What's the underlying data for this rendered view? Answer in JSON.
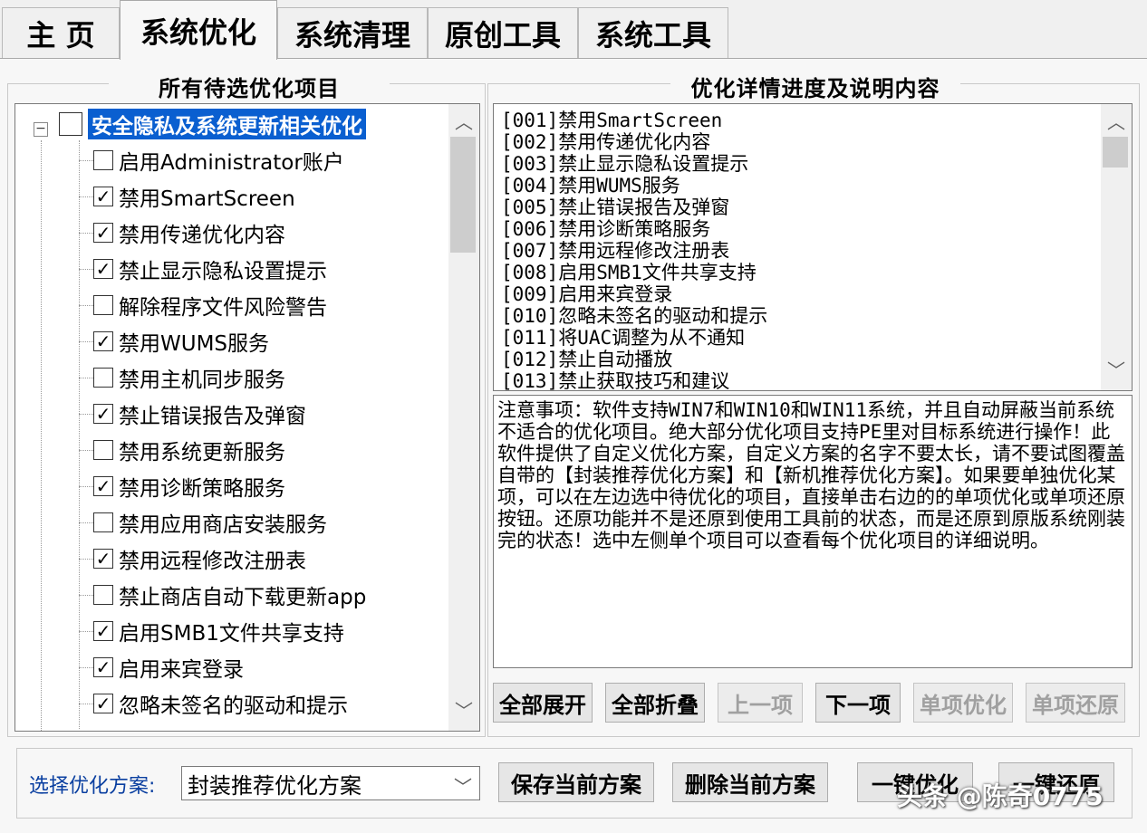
{
  "tabs": [
    {
      "label": "主 页",
      "active": false
    },
    {
      "label": "系统优化",
      "active": true
    },
    {
      "label": "系统清理",
      "active": false
    },
    {
      "label": "原创工具",
      "active": false
    },
    {
      "label": "系统工具",
      "active": false
    }
  ],
  "left_panel": {
    "title": "所有待选优化项目",
    "root": {
      "label": "安全隐私及系统更新相关优化",
      "checked": false,
      "expander": "−"
    },
    "items": [
      {
        "label": "启用Administrator账户",
        "checked": false
      },
      {
        "label": "禁用SmartScreen",
        "checked": true
      },
      {
        "label": "禁用传递优化内容",
        "checked": true
      },
      {
        "label": "禁止显示隐私设置提示",
        "checked": true
      },
      {
        "label": "解除程序文件风险警告",
        "checked": false
      },
      {
        "label": "禁用WUMS服务",
        "checked": true
      },
      {
        "label": "禁用主机同步服务",
        "checked": false
      },
      {
        "label": "禁止错误报告及弹窗",
        "checked": true
      },
      {
        "label": "禁用系统更新服务",
        "checked": false
      },
      {
        "label": "禁用诊断策略服务",
        "checked": true
      },
      {
        "label": "禁用应用商店安装服务",
        "checked": false
      },
      {
        "label": "禁用远程修改注册表",
        "checked": true
      },
      {
        "label": "禁止商店自动下载更新app",
        "checked": false
      },
      {
        "label": "启用SMB1文件共享支持",
        "checked": true
      },
      {
        "label": "启用来宾登录",
        "checked": true
      },
      {
        "label": "忽略未签名的驱动和提示",
        "checked": true
      }
    ]
  },
  "right_panel": {
    "title": "优化详情进度及说明内容",
    "list": [
      "[001]禁用SmartScreen",
      "[002]禁用传递优化内容",
      "[003]禁止显示隐私设置提示",
      "[004]禁用WUMS服务",
      "[005]禁止错误报告及弹窗",
      "[006]禁用诊断策略服务",
      "[007]禁用远程修改注册表",
      "[008]启用SMB1文件共享支持",
      "[009]启用来宾登录",
      "[010]忽略未签名的驱动和提示",
      "[011]将UAC调整为从不通知",
      "[012]禁止自动播放",
      "[013]禁止获取技巧和建议"
    ],
    "note": "注意事项：软件支持WIN7和WIN10和WIN11系统，并且自动屏蔽当前系统不适合的优化项目。绝大部分优化项目支持PE里对目标系统进行操作！此软件提供了自定义优化方案，自定义方案的名字不要太长，请不要试图覆盖自带的【封装推荐优化方案】和【新机推荐优化方案】。如果要单独优化某项，可以在左边选中待优化的项目，直接单击右边的的单项优化或单项还原按钮。还原功能并不是还原到使用工具前的状态，而是还原到原版系统刚装完的状态！选中左侧单个项目可以查看每个优化项目的详细说明。"
  },
  "buttons": {
    "expand_all": "全部展开",
    "collapse_all": "全部折叠",
    "prev": "上一项",
    "next": "下一项",
    "single_optimize": "单项优化",
    "single_restore": "单项还原",
    "save_scheme": "保存当前方案",
    "delete_scheme": "删除当前方案",
    "one_key_optimize": "一键优化",
    "one_key_restore": "一键还原"
  },
  "scheme": {
    "label": "选择优化方案:",
    "selected": "封装推荐优化方案"
  },
  "watermark": "头条 @陈奇0775",
  "colors": {
    "selection": "#0a5fd0",
    "background": "#f0f0f0",
    "disabled_text": "#a0a0a0"
  }
}
